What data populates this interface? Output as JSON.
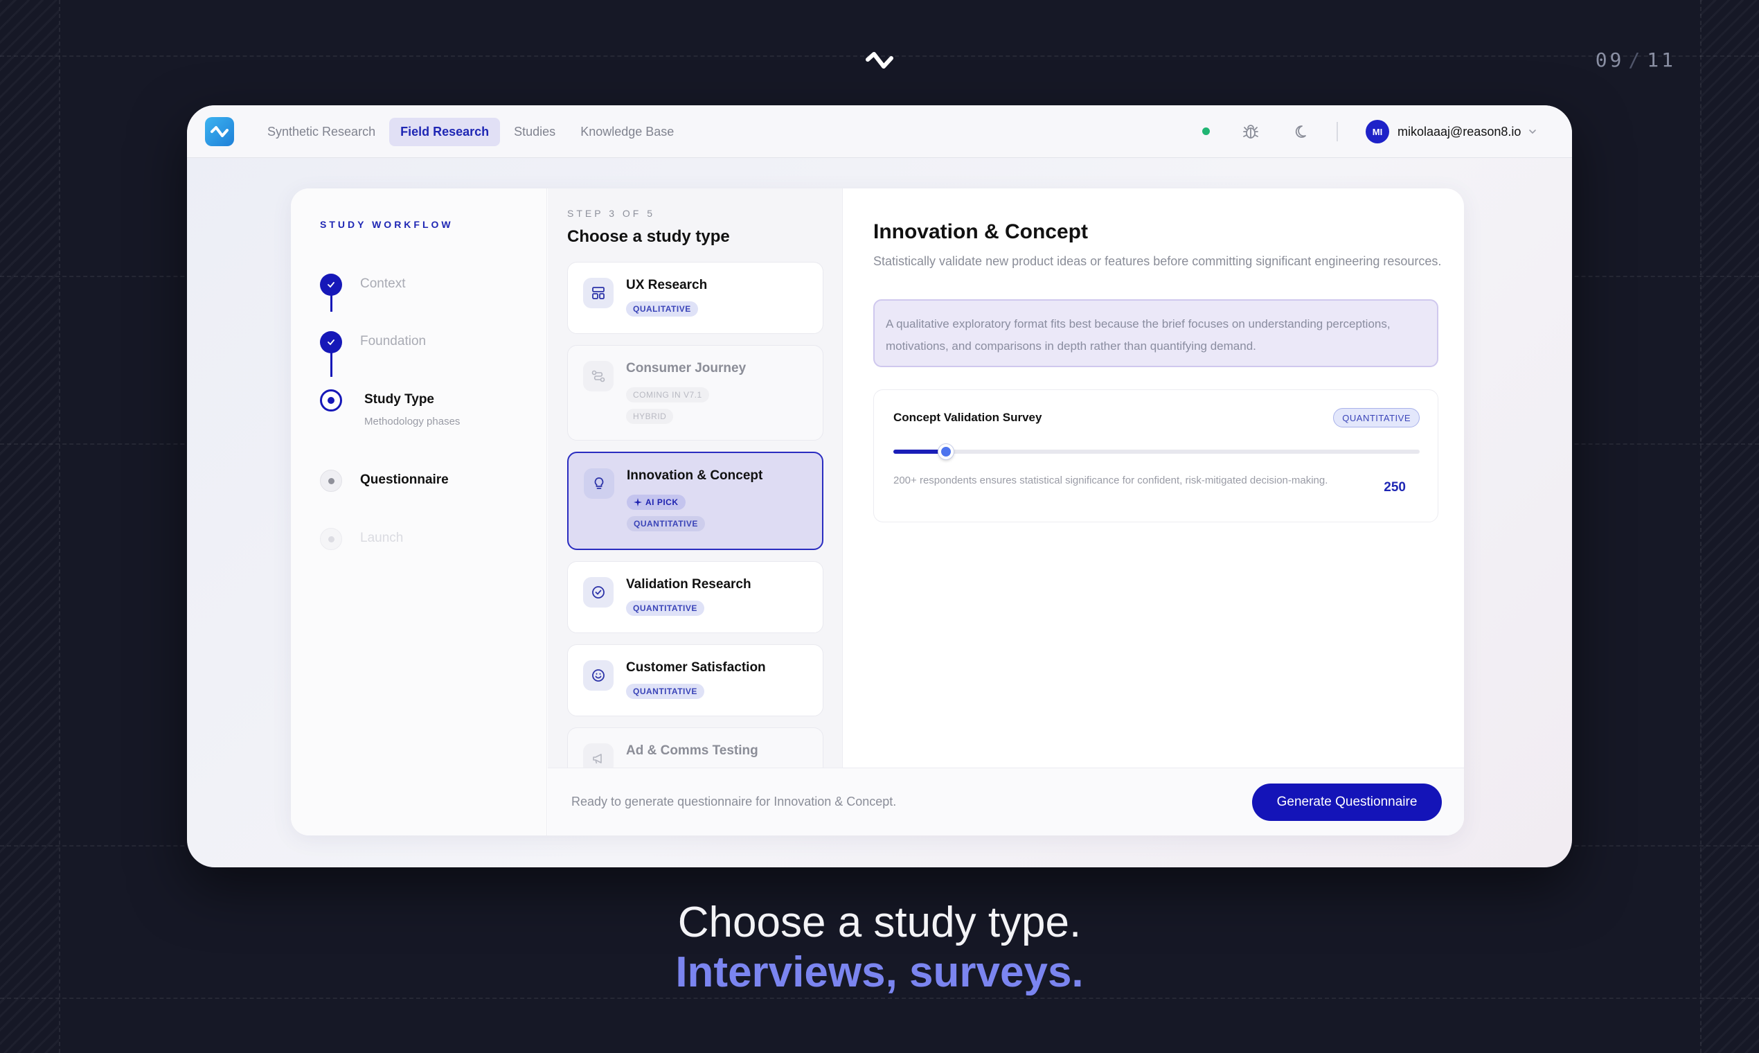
{
  "page_counter": {
    "current": "09",
    "separator": "/",
    "total": "11"
  },
  "topbar": {
    "nav": [
      "Synthetic Research",
      "Field Research",
      "Studies",
      "Knowledge Base"
    ],
    "active_nav_index": 1,
    "user": {
      "initials": "MI",
      "email": "mikolaaaj@reason8.io"
    }
  },
  "sidebar": {
    "title": "STUDY WORKFLOW",
    "steps": [
      {
        "label": "Context",
        "status": "done"
      },
      {
        "label": "Foundation",
        "status": "done"
      },
      {
        "label": "Study Type",
        "sub": "Methodology phases",
        "status": "current"
      },
      {
        "label": "Questionnaire",
        "status": "pending"
      },
      {
        "label": "Launch",
        "status": "disabled"
      }
    ]
  },
  "types": {
    "kicker": "STEP 3 OF 5",
    "title": "Choose a study type",
    "items": [
      {
        "name": "UX Research",
        "badges": [
          "QUALITATIVE"
        ],
        "icon": "layout-icon"
      },
      {
        "name": "Consumer Journey",
        "badges": [
          "COMING IN V7.1",
          "HYBRID"
        ],
        "icon": "route-icon",
        "disabled": true
      },
      {
        "name": "Innovation & Concept",
        "ai_pick": "AI PICK",
        "badges": [
          "QUANTITATIVE"
        ],
        "icon": "lightbulb-icon",
        "selected": true
      },
      {
        "name": "Validation Research",
        "badges": [
          "QUANTITATIVE"
        ],
        "icon": "check-circle-icon"
      },
      {
        "name": "Customer Satisfaction",
        "badges": [
          "QUANTITATIVE"
        ],
        "icon": "smile-icon"
      },
      {
        "name": "Ad & Comms Testing",
        "badges": [],
        "icon": "megaphone-icon",
        "disabled": true
      }
    ]
  },
  "detail": {
    "title": "Innovation & Concept",
    "description": "Statistically validate new product ideas or features before committing significant engineering resources.",
    "note": "A qualitative exploratory format fits best because the brief focuses on understanding perceptions, motivations, and comparisons in depth rather than quantifying demand.",
    "survey": {
      "title": "Concept Validation Survey",
      "badge": "QUANTITATIVE",
      "help": "200+ respondents ensures statistical significance for confident, risk-mitigated decision-making.",
      "count": "250",
      "slider_fraction": 0.1
    }
  },
  "footer": {
    "status": "Ready to generate questionnaire for Innovation & Concept.",
    "button": "Generate Questionnaire"
  },
  "caption": {
    "line1": "Choose a study type.",
    "line2": "Interviews, surveys."
  },
  "colors": {
    "accent": "#1414b8",
    "caption_accent": "#7b85f0",
    "status_online": "#21b573"
  }
}
